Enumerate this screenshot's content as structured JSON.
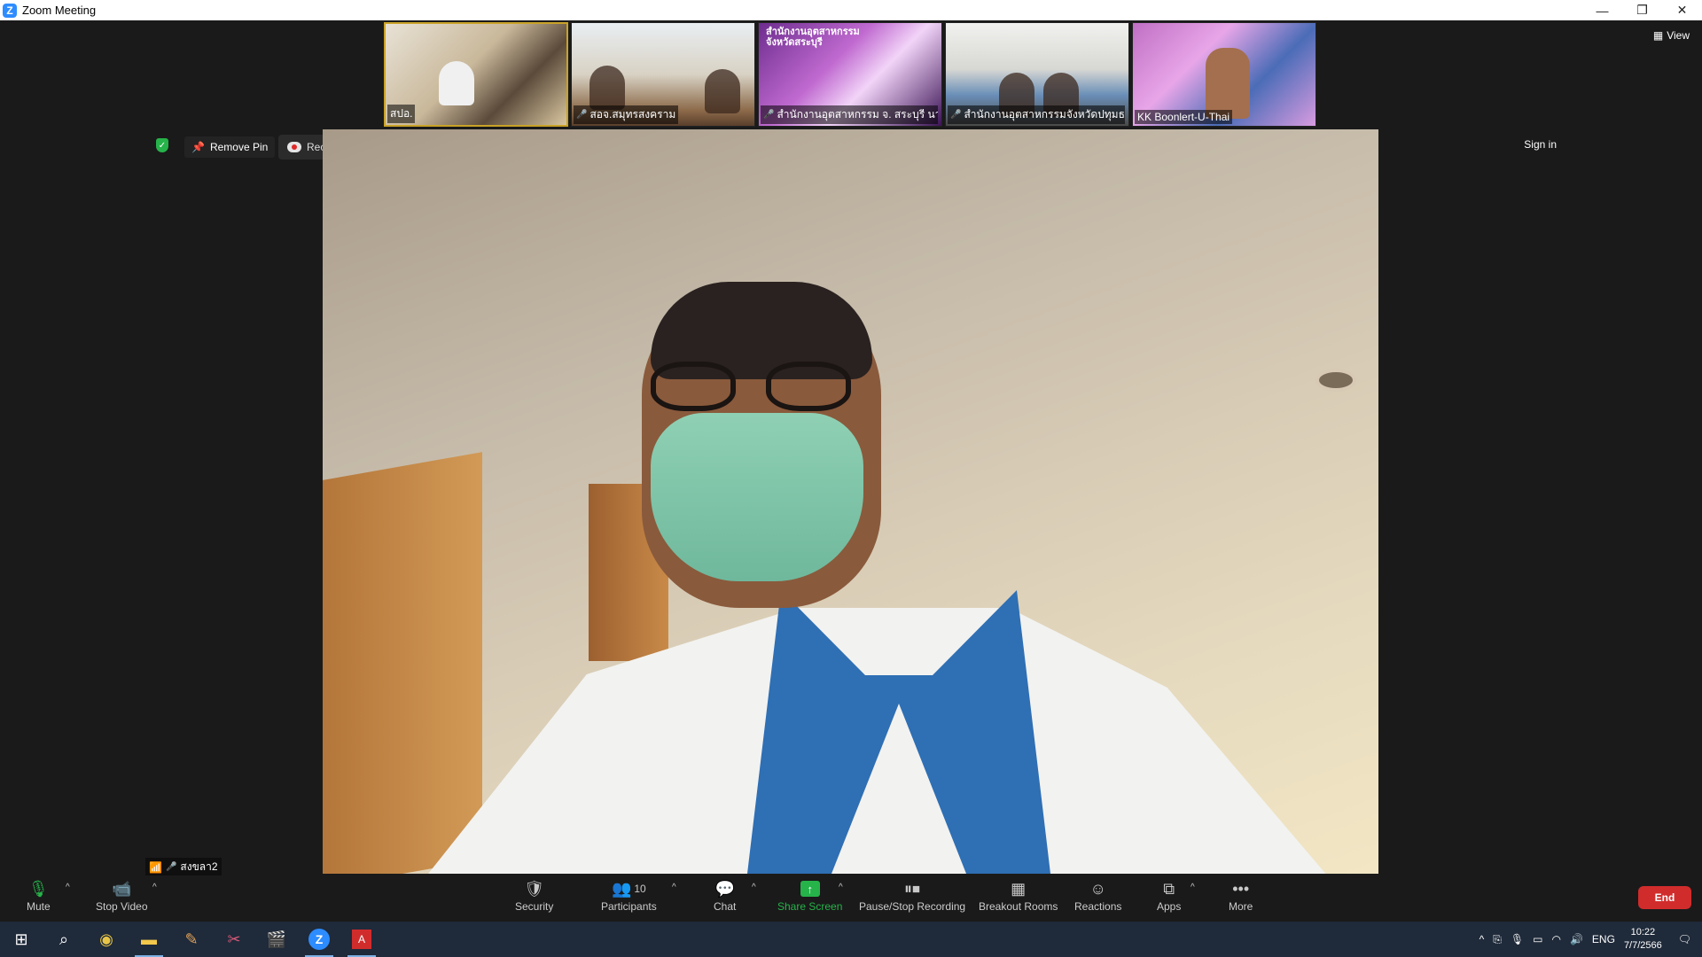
{
  "window": {
    "title": "Zoom Meeting",
    "controls": [
      "—",
      "❐",
      "✕"
    ]
  },
  "gallery": {
    "view_label": "View",
    "participants": [
      {
        "name": "สปอ.",
        "muted": false
      },
      {
        "name": "สอจ.สมุทรสงคราม",
        "muted": true
      },
      {
        "name": "สำนักงานอุตสาหกรรม จ. สระบุรี นา...",
        "muted": true
      },
      {
        "name": "สำนักงานอุตสาหกรรมจังหวัดปทุมธ...",
        "muted": true
      },
      {
        "name": "KK Boonlert-U-Thai",
        "muted": false
      }
    ],
    "thumb3_banner": "สำนักงานอุตสาหกรรม จังหวัดสระบุรี"
  },
  "top_controls": {
    "remove_pin": "Remove Pin",
    "recording": "Recording...",
    "sign_in": "Sign in"
  },
  "self_view": {
    "name": "สงขลา2"
  },
  "toolbar": {
    "mute": "Mute",
    "stop_video": "Stop Video",
    "security": "Security",
    "participants": "Participants",
    "participant_count": "10",
    "chat": "Chat",
    "share_screen": "Share Screen",
    "pause_stop_recording": "Pause/Stop Recording",
    "breakout_rooms": "Breakout Rooms",
    "reactions": "Reactions",
    "apps": "Apps",
    "more": "More",
    "end": "End"
  },
  "taskbar": {
    "lang": "ENG",
    "time": "10:22",
    "date": "7/7/2566"
  },
  "colors": {
    "accent_green": "#26b34a",
    "end_red": "#d12c2c",
    "zoom_blue": "#2d8cff"
  }
}
